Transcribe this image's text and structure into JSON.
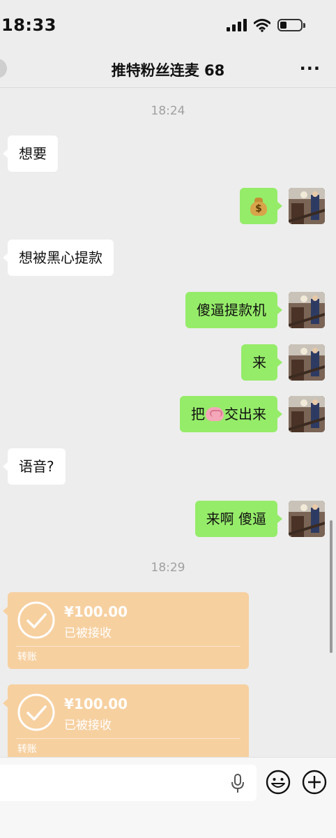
{
  "status_bar": {
    "time": "18:33"
  },
  "header": {
    "title": "推特粉丝连麦 68",
    "more": "···"
  },
  "timestamps": [
    "18:24",
    "18:29"
  ],
  "messages": [
    {
      "side": "in",
      "text": "想要"
    },
    {
      "side": "out",
      "emoji": "money-bag-icon"
    },
    {
      "side": "in",
      "text": "想被黑心提款"
    },
    {
      "side": "out",
      "text": "傻逼提款机"
    },
    {
      "side": "out",
      "text": "来"
    },
    {
      "side": "out",
      "text_before": "把",
      "emoji": "brain-icon",
      "text_after": "交出来"
    },
    {
      "side": "in",
      "text": "语音?"
    },
    {
      "side": "out",
      "text": "来啊 傻逼"
    }
  ],
  "transfers": [
    {
      "amount": "¥100.00",
      "status": "已被接收",
      "label": "转账"
    },
    {
      "amount": "¥100.00",
      "status": "已被接收",
      "label": "转账"
    }
  ],
  "colors": {
    "outgoing_bubble": "#95ec69",
    "incoming_bubble": "#ffffff",
    "transfer_card": "#f7d0a0",
    "background": "#ededed"
  }
}
